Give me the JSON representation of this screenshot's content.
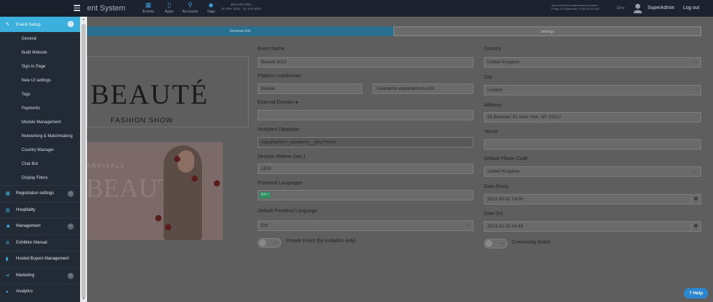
{
  "topbar": {
    "title": "ent System",
    "nav": [
      {
        "label": "Events",
        "icon": "calendar-icon"
      },
      {
        "label": "Apps",
        "icon": "mobile-icon"
      },
      {
        "label": "Accounts",
        "icon": "key-icon"
      },
      {
        "label": "Tags",
        "icon": "tag-icon"
      }
    ],
    "event_name": "BEAUTE 2022",
    "event_dates": "31 MAY 2022 - 31 JAN 2023",
    "maintenance_line1": "Next scheduled maintenance window:",
    "maintenance_line2": "Friday 30 September 07:00-09:00 GMT",
    "lang": "EN ▾",
    "user": "SuperAdmin",
    "logout": "Log out"
  },
  "sidebar": {
    "main": {
      "label": "Event Setup",
      "icon": "pencil-icon"
    },
    "sub_items": [
      "General",
      "Build Website",
      "Sign In Page",
      "New UI settings",
      "Tags",
      "Payments",
      "Module Management",
      "Networking & Matchmaking",
      "Country Manager",
      "Chat Bot",
      "Display Filters"
    ],
    "sections": [
      {
        "label": "Registration settings",
        "icon": "grid-icon",
        "badge": true
      },
      {
        "label": "Hospitality",
        "icon": "building-icon",
        "badge": false
      },
      {
        "label": "Management",
        "icon": "users-icon",
        "badge": true
      },
      {
        "label": "Exhibitor Manual",
        "icon": "gear-icon",
        "badge": false
      },
      {
        "label": "Hosted Buyers Management",
        "icon": "chart-icon",
        "badge": false
      },
      {
        "label": "Marketing",
        "icon": "share-icon",
        "badge": true
      },
      {
        "label": "Analytics",
        "icon": "pie-icon",
        "badge": false
      }
    ]
  },
  "tabs": {
    "general": "General info",
    "settings": "Settings"
  },
  "logo": {
    "word": "BEAUTÉ",
    "sub": "FASHION SHOW"
  },
  "banner": {
    "line1": "ARRIVALS",
    "line2": "BEAUTÉ"
  },
  "form": {
    "event_name_label": "Event Name",
    "event_name": "Beauté 2022",
    "subdomain_label": "Platform subdomain",
    "subdomain": "beaute",
    "subdomain_suffix": "-newdemo.expoplatform.com",
    "external_domain_label": "External Domain",
    "external_domain": "",
    "analytics_label": "Analytics Database",
    "analytics_value": "expoplatform_newdemo__dkvj7t41nz",
    "session_label": "Session lifetime (sec.)",
    "session_value": "1000",
    "frontend_lang_label": "Frontend Languages",
    "frontend_lang_chip": "EN ×",
    "default_lang_label": "Default Frontend Language",
    "default_lang": "EN",
    "private_label": "Private Event (by invitation only)",
    "country_label": "Country",
    "country": "United Kingdom",
    "city_label": "City",
    "city": "London",
    "address_label": "Address",
    "address": "65 Bleecker St, New York, NY 10012",
    "venue_label": "Venue",
    "venue": "",
    "phone_label": "Default Phone Code",
    "phone": "United Kingdom",
    "date_from_label": "Date (from)",
    "date_from": "2022-05-31 14:00",
    "date_to_label": "Date (to)",
    "date_to": "2023-01-31 03:45",
    "community_label": "Community Event"
  },
  "help": "Help"
}
